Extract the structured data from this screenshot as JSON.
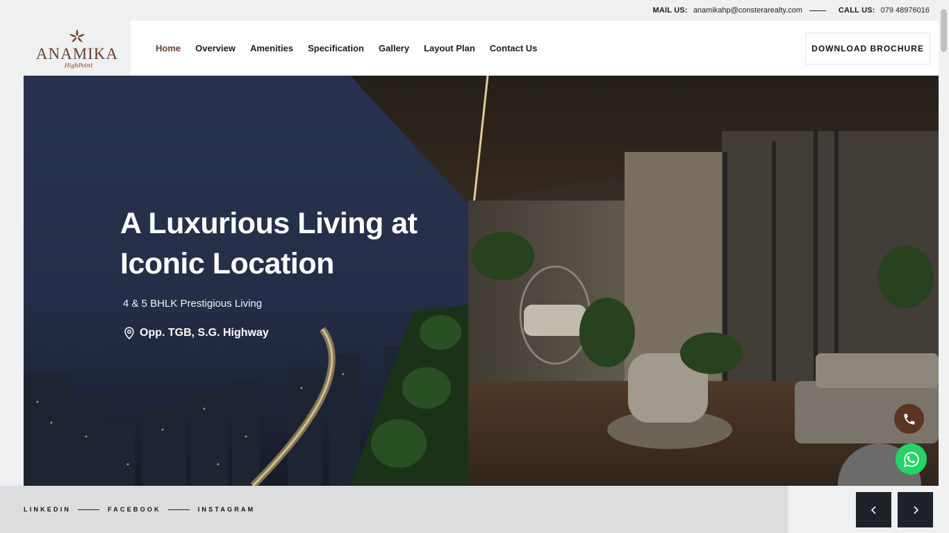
{
  "topbar": {
    "mail_label": "MAIL US:",
    "mail_value": "anamikahp@consterarealty.com",
    "call_label": "CALL US:",
    "call_value": "079 48976016"
  },
  "logo": {
    "brand": "ANAMIKA",
    "tagline": "HighPoint",
    "icon": "flower-icon"
  },
  "nav": {
    "items": [
      {
        "label": "Home",
        "active": true
      },
      {
        "label": "Overview"
      },
      {
        "label": "Amenities"
      },
      {
        "label": "Specification"
      },
      {
        "label": "Gallery"
      },
      {
        "label": "Layout Plan"
      },
      {
        "label": "Contact Us"
      }
    ],
    "cta": "DOWNLOAD BROCHURE"
  },
  "hero": {
    "title_line1": "A Luxurious Living at",
    "title_line2": "Iconic Location",
    "subtitle": "4 & 5 BHLK Prestigious Living",
    "location": "Opp. TGB, S.G. Highway",
    "location_icon": "map-pin-icon"
  },
  "floating": {
    "call_icon": "phone-icon",
    "whatsapp_icon": "whatsapp-icon"
  },
  "social": {
    "links": [
      "LINKEDIN",
      "FACEBOOK",
      "INSTAGRAM"
    ]
  },
  "slider": {
    "prev_icon": "chevron-left-icon",
    "next_icon": "chevron-right-icon"
  },
  "colors": {
    "brand": "#6b3e2a",
    "dark_button": "#1c2228",
    "whatsapp": "#25d366",
    "call_button": "#5c3422"
  }
}
